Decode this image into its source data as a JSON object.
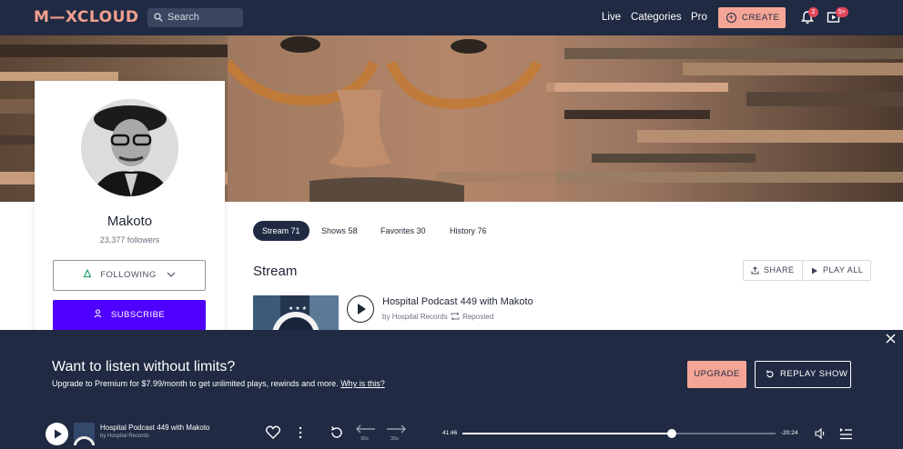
{
  "header": {
    "logo": "M—XCLOUD",
    "search_placeholder": "Search",
    "nav": [
      "Live",
      "Categories",
      "Pro"
    ],
    "create_label": "CREATE",
    "notifications_badge": "2",
    "queue_badge": "5+"
  },
  "profile": {
    "name": "Makoto",
    "followers": "23,377 followers",
    "following_label": "FOLLOWING",
    "subscribe_label": "SUBSCRIBE"
  },
  "tabs": [
    {
      "label": "Stream 71",
      "active": true
    },
    {
      "label": "Shows 58",
      "active": false
    },
    {
      "label": "Favorites 30",
      "active": false
    },
    {
      "label": "History 76",
      "active": false
    }
  ],
  "stream": {
    "title": "Stream",
    "share_label": "SHARE",
    "play_all_label": "PLAY ALL",
    "show": {
      "title": "Hospital Podcast 449 with Makoto",
      "by_prefix": "by",
      "by": "Hospital Records",
      "reposted": "Reposted"
    }
  },
  "upsell": {
    "title": "Want to listen without limits?",
    "text": "Upgrade to Premium for $7.99/month to get unlimited plays, rewinds and more.",
    "link": "Why is this?",
    "upgrade_label": "UPGRADE",
    "replay_label": "REPLAY SHOW"
  },
  "player": {
    "title": "Hospital Podcast 449 with Makoto",
    "artist": "by Hospital Records",
    "elapsed": "41:46",
    "remaining": "-20:24",
    "progress": 0.67,
    "rewind_label": "30s",
    "forward_label": "30s"
  },
  "colors": {
    "navy": "#202a43",
    "salmon": "#f4a596",
    "purple": "#5000ff"
  }
}
